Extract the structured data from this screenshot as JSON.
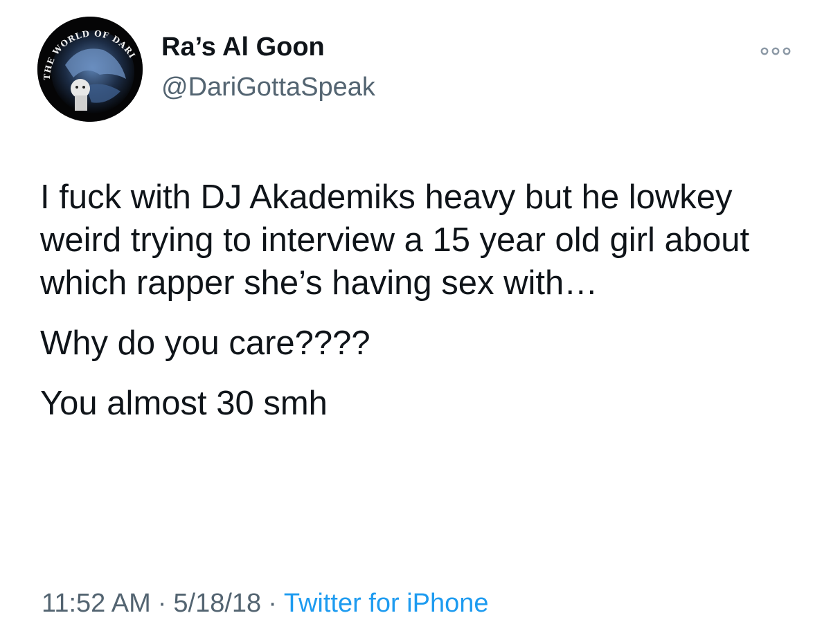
{
  "user": {
    "display_name": "Ra’s Al Goon",
    "handle": "@DariGottaSpeak",
    "avatar_text": "THE WORLD OF DARI"
  },
  "more_icon": "more-dots-icon",
  "tweet": {
    "paragraphs": [
      "I fuck with DJ Akademiks heavy but he lowkey weird trying to interview a 15 year old girl about which rapper she’s having sex with…",
      "Why do you care????",
      "You almost 30 smh"
    ]
  },
  "meta": {
    "time": "11:52 AM",
    "separator": "·",
    "date": "5/18/18",
    "source": "Twitter for iPhone"
  },
  "colors": {
    "text": "#0f1419",
    "secondary": "#536471",
    "link": "#1d9bf0"
  }
}
